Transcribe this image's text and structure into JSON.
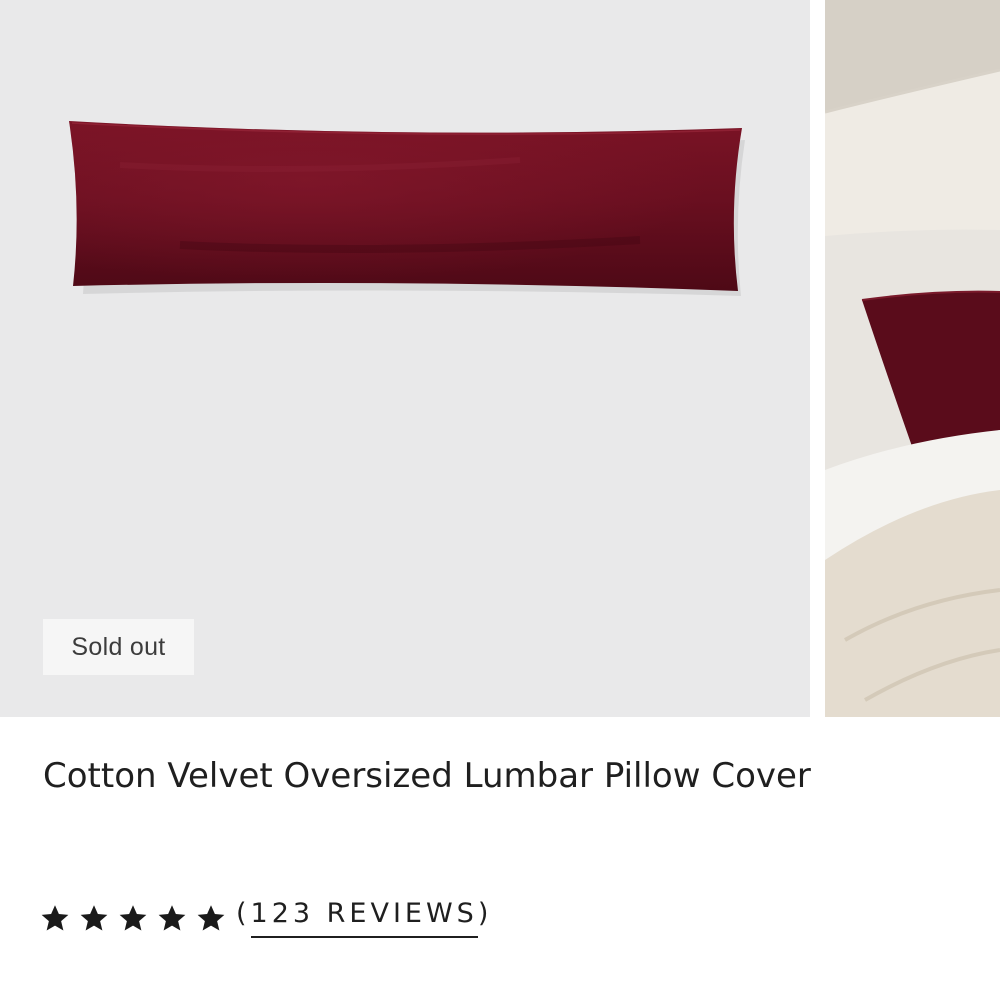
{
  "product": {
    "title": "Cotton Velvet Oversized Lumbar Pillow Cover",
    "badge": "Sold out",
    "rating_value": 5,
    "rating_max": 5,
    "reviews": {
      "open_paren": "(",
      "label": "123 REVIEWS",
      "close_paren": ")"
    }
  },
  "images": {
    "main_alt": "Cotton Velvet Oversized Lumbar Pillow Cover",
    "secondary_alt": "Cotton Velvet Oversized Lumbar Pillow Cover on bed"
  },
  "colors": {
    "pillow": "#5e0d1c",
    "image_bg": "#e9e9ea",
    "text": "#1f1f1f",
    "star": "#1a1a1a"
  },
  "icons": {
    "star": "star-icon"
  }
}
